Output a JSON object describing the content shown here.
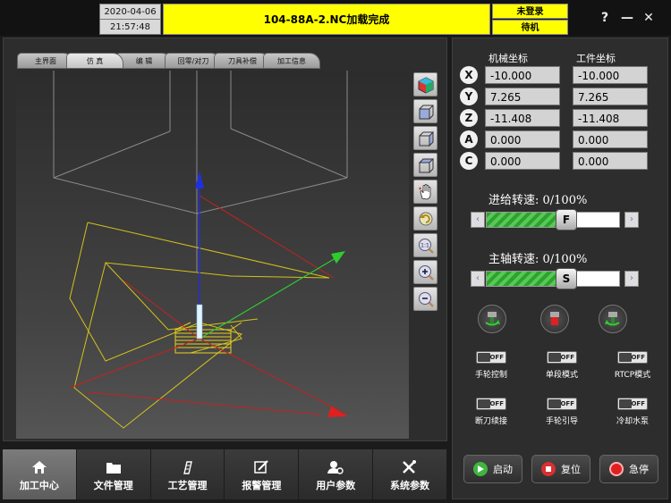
{
  "header": {
    "date": "2020-04-06",
    "time": "21:57:48",
    "file_status": "104-88A-2.NC加载完成",
    "login_status": "未登录",
    "machine_state": "待机",
    "help_label": "?",
    "minimize_label": "—",
    "close_label": "✕"
  },
  "tabs": [
    {
      "label": "主界面"
    },
    {
      "label": "仿 真",
      "active": true
    },
    {
      "label": "编 辑"
    },
    {
      "label": "回零/对刀"
    },
    {
      "label": "刀具补偿"
    },
    {
      "label": "加工信息"
    }
  ],
  "view_tools": [
    "view-iso-icon",
    "view-front-icon",
    "view-side-icon",
    "view-top-icon",
    "pan-hand-icon",
    "rotate-view-icon",
    "zoom-fit-icon",
    "zoom-in-icon",
    "zoom-out-icon"
  ],
  "coordinates": {
    "machine_header": "机械坐标",
    "work_header": "工件坐标",
    "axes": [
      {
        "axis": "X",
        "machine": "-10.000",
        "work": "-10.000"
      },
      {
        "axis": "Y",
        "machine": "7.265",
        "work": "7.265"
      },
      {
        "axis": "Z",
        "machine": "-11.408",
        "work": "-11.408"
      },
      {
        "axis": "A",
        "machine": "0.000",
        "work": "0.000"
      },
      {
        "axis": "C",
        "machine": "0.000",
        "work": "0.000"
      }
    ]
  },
  "feed": {
    "label": "进给转速: 0/100%",
    "knob": "F",
    "level": 0.6
  },
  "spindle": {
    "label": "主轴转速: 0/100%",
    "knob": "S",
    "level": 0.6
  },
  "toggles": [
    {
      "label": "手轮控制",
      "state": "OFF"
    },
    {
      "label": "单段模式",
      "state": "OFF"
    },
    {
      "label": "RTCP模式",
      "state": "OFF"
    },
    {
      "label": "断刀续接",
      "state": "OFF"
    },
    {
      "label": "手轮引导",
      "state": "OFF"
    },
    {
      "label": "冷却水泵",
      "state": "OFF"
    }
  ],
  "actions": {
    "start": "启动",
    "reset": "复位",
    "estop": "急停"
  },
  "nav": [
    {
      "label": "加工中心",
      "active": true
    },
    {
      "label": "文件管理"
    },
    {
      "label": "工艺管理"
    },
    {
      "label": "报警管理"
    },
    {
      "label": "用户参数"
    },
    {
      "label": "系统参数"
    }
  ],
  "colors": {
    "status_yellow": "#ffff00",
    "slider_green": "#3cb43c",
    "estop_red": "#e02020",
    "start_green": "#3fb63f"
  }
}
